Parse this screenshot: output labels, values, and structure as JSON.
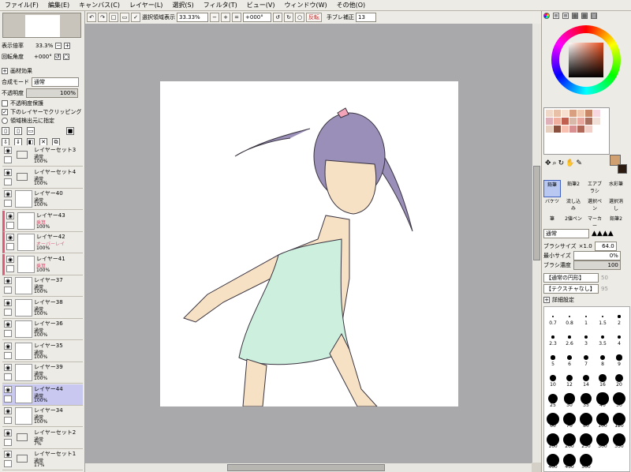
{
  "menu": [
    "ファイル(F)",
    "編集(E)",
    "キャンバス(C)",
    "レイヤー(L)",
    "選択(S)",
    "フィルタ(T)",
    "ビュー(V)",
    "ウィンドウ(W)",
    "その他(O)"
  ],
  "toolbar": {
    "select_area_label": "選択領域表示",
    "zoom": "33.33%",
    "rotation": "+000°",
    "flip_label": "反転",
    "stabilizer_label": "手ブレ補正",
    "stabilizer_value": "13"
  },
  "navigator": {
    "zoom_label": "表示倍率",
    "zoom_value": "33.3%",
    "rotate_label": "回転角度",
    "rotate_value": "+000°"
  },
  "material": {
    "header": "画材効果",
    "blend_label": "合成モード",
    "blend_value": "通常",
    "opacity_label": "不透明度",
    "opacity_value": "100%",
    "protect_label": "不透明度保護",
    "clip_label": "下のレイヤーでクリッピング",
    "source_label": "領域検出元に指定"
  },
  "layers": [
    {
      "name": "レイヤーセット3",
      "mode": "通常",
      "opacity": "100%",
      "folder": true
    },
    {
      "name": "レイヤーセット4",
      "mode": "通常",
      "opacity": "100%",
      "folder": true
    },
    {
      "name": "レイヤー40",
      "mode": "通常",
      "opacity": "100%"
    },
    {
      "name": "レイヤー43",
      "mode": "乗算",
      "opacity": "100%"
    },
    {
      "name": "レイヤー42",
      "mode": "オーバーレイ",
      "opacity": "100%"
    },
    {
      "name": "レイヤー41",
      "mode": "乗算",
      "opacity": "100%"
    },
    {
      "name": "レイヤー37",
      "mode": "通常",
      "opacity": "100%"
    },
    {
      "name": "レイヤー38",
      "mode": "通常",
      "opacity": "100%"
    },
    {
      "name": "レイヤー36",
      "mode": "通常",
      "opacity": "100%"
    },
    {
      "name": "レイヤー35",
      "mode": "通常",
      "opacity": "100%"
    },
    {
      "name": "レイヤー39",
      "mode": "通常",
      "opacity": "100%"
    },
    {
      "name": "レイヤー44",
      "mode": "通常",
      "opacity": "100%",
      "selected": true
    },
    {
      "name": "レイヤー34",
      "mode": "通常",
      "opacity": "100%"
    },
    {
      "name": "レイヤーセット2",
      "mode": "通常",
      "opacity": "7%",
      "folder": true
    },
    {
      "name": "レイヤーセット1",
      "mode": "通常",
      "opacity": "17%",
      "folder": true
    }
  ],
  "tools": [
    [
      "鉛筆",
      "鉛筆2",
      "エアブラシ",
      "水彩筆"
    ],
    [
      "バケツ",
      "流し込み",
      "選択ペン",
      "選択消し"
    ],
    [
      "筆",
      "2値ペン",
      "マーカー",
      "鉛筆2"
    ]
  ],
  "brush": {
    "mode": "通常",
    "size_label": "ブラシサイズ",
    "size_mult": "×1.0",
    "size_value": "64.0",
    "min_label": "最小サイズ",
    "min_value": "0%",
    "density_label": "ブラシ濃度",
    "density_value": "100",
    "shape1": "【通常の円形】",
    "shape1_val": "50",
    "shape2": "【テクスチャなし】",
    "shape2_val": "95",
    "detail_label": "詳細設定"
  },
  "brush_sizes": [
    "0.7",
    "0.8",
    "1",
    "1.5",
    "2",
    "2.3",
    "2.6",
    "3",
    "3.5",
    "4",
    "5",
    "6",
    "7",
    "8",
    "9",
    "10",
    "12",
    "14",
    "16",
    "20",
    "25",
    "30",
    "35",
    "40",
    "50",
    "60",
    "70",
    "80",
    "100",
    "120",
    "160",
    "200",
    "250",
    "300",
    "350",
    "400",
    "450",
    "500"
  ],
  "colors": {
    "accent": "#e05a7a",
    "canvas_bg": "#a9a9ac",
    "panel": "#ecebe6"
  }
}
